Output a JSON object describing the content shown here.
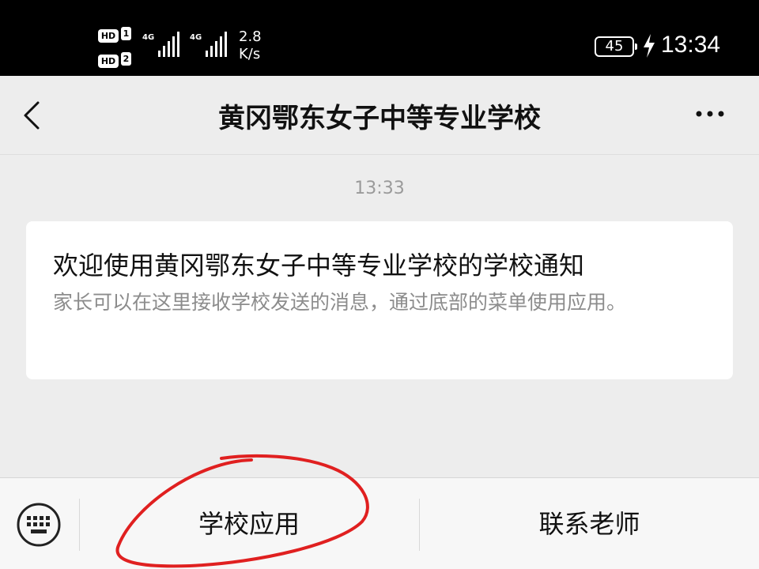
{
  "status_bar": {
    "hd_label": "HD",
    "sim1": "1",
    "sim2": "2",
    "network1": "4G",
    "network2": "4G",
    "speed_value": "2.8",
    "speed_unit": "K/s",
    "battery": "45",
    "time": "13:34",
    "icons": [
      "signal-icon",
      "charging-icon"
    ]
  },
  "navbar": {
    "back_icon": "chevron-left-icon",
    "title": "黄冈鄂东女子中等专业学校",
    "more_icon": "more-icon"
  },
  "chat": {
    "timestamp": "13:33",
    "message": {
      "title": "欢迎使用黄冈鄂东女子中等专业学校的学校通知",
      "body": "家长可以在这里接收学校发送的消息，通过底部的菜单使用应用。"
    }
  },
  "bottom_menu": {
    "keyboard_icon": "keyboard-icon",
    "items": [
      {
        "label": "学校应用"
      },
      {
        "label": "联系老师"
      }
    ]
  },
  "colors": {
    "background": "#ededed",
    "card": "#ffffff",
    "annotation": "#e02020"
  }
}
